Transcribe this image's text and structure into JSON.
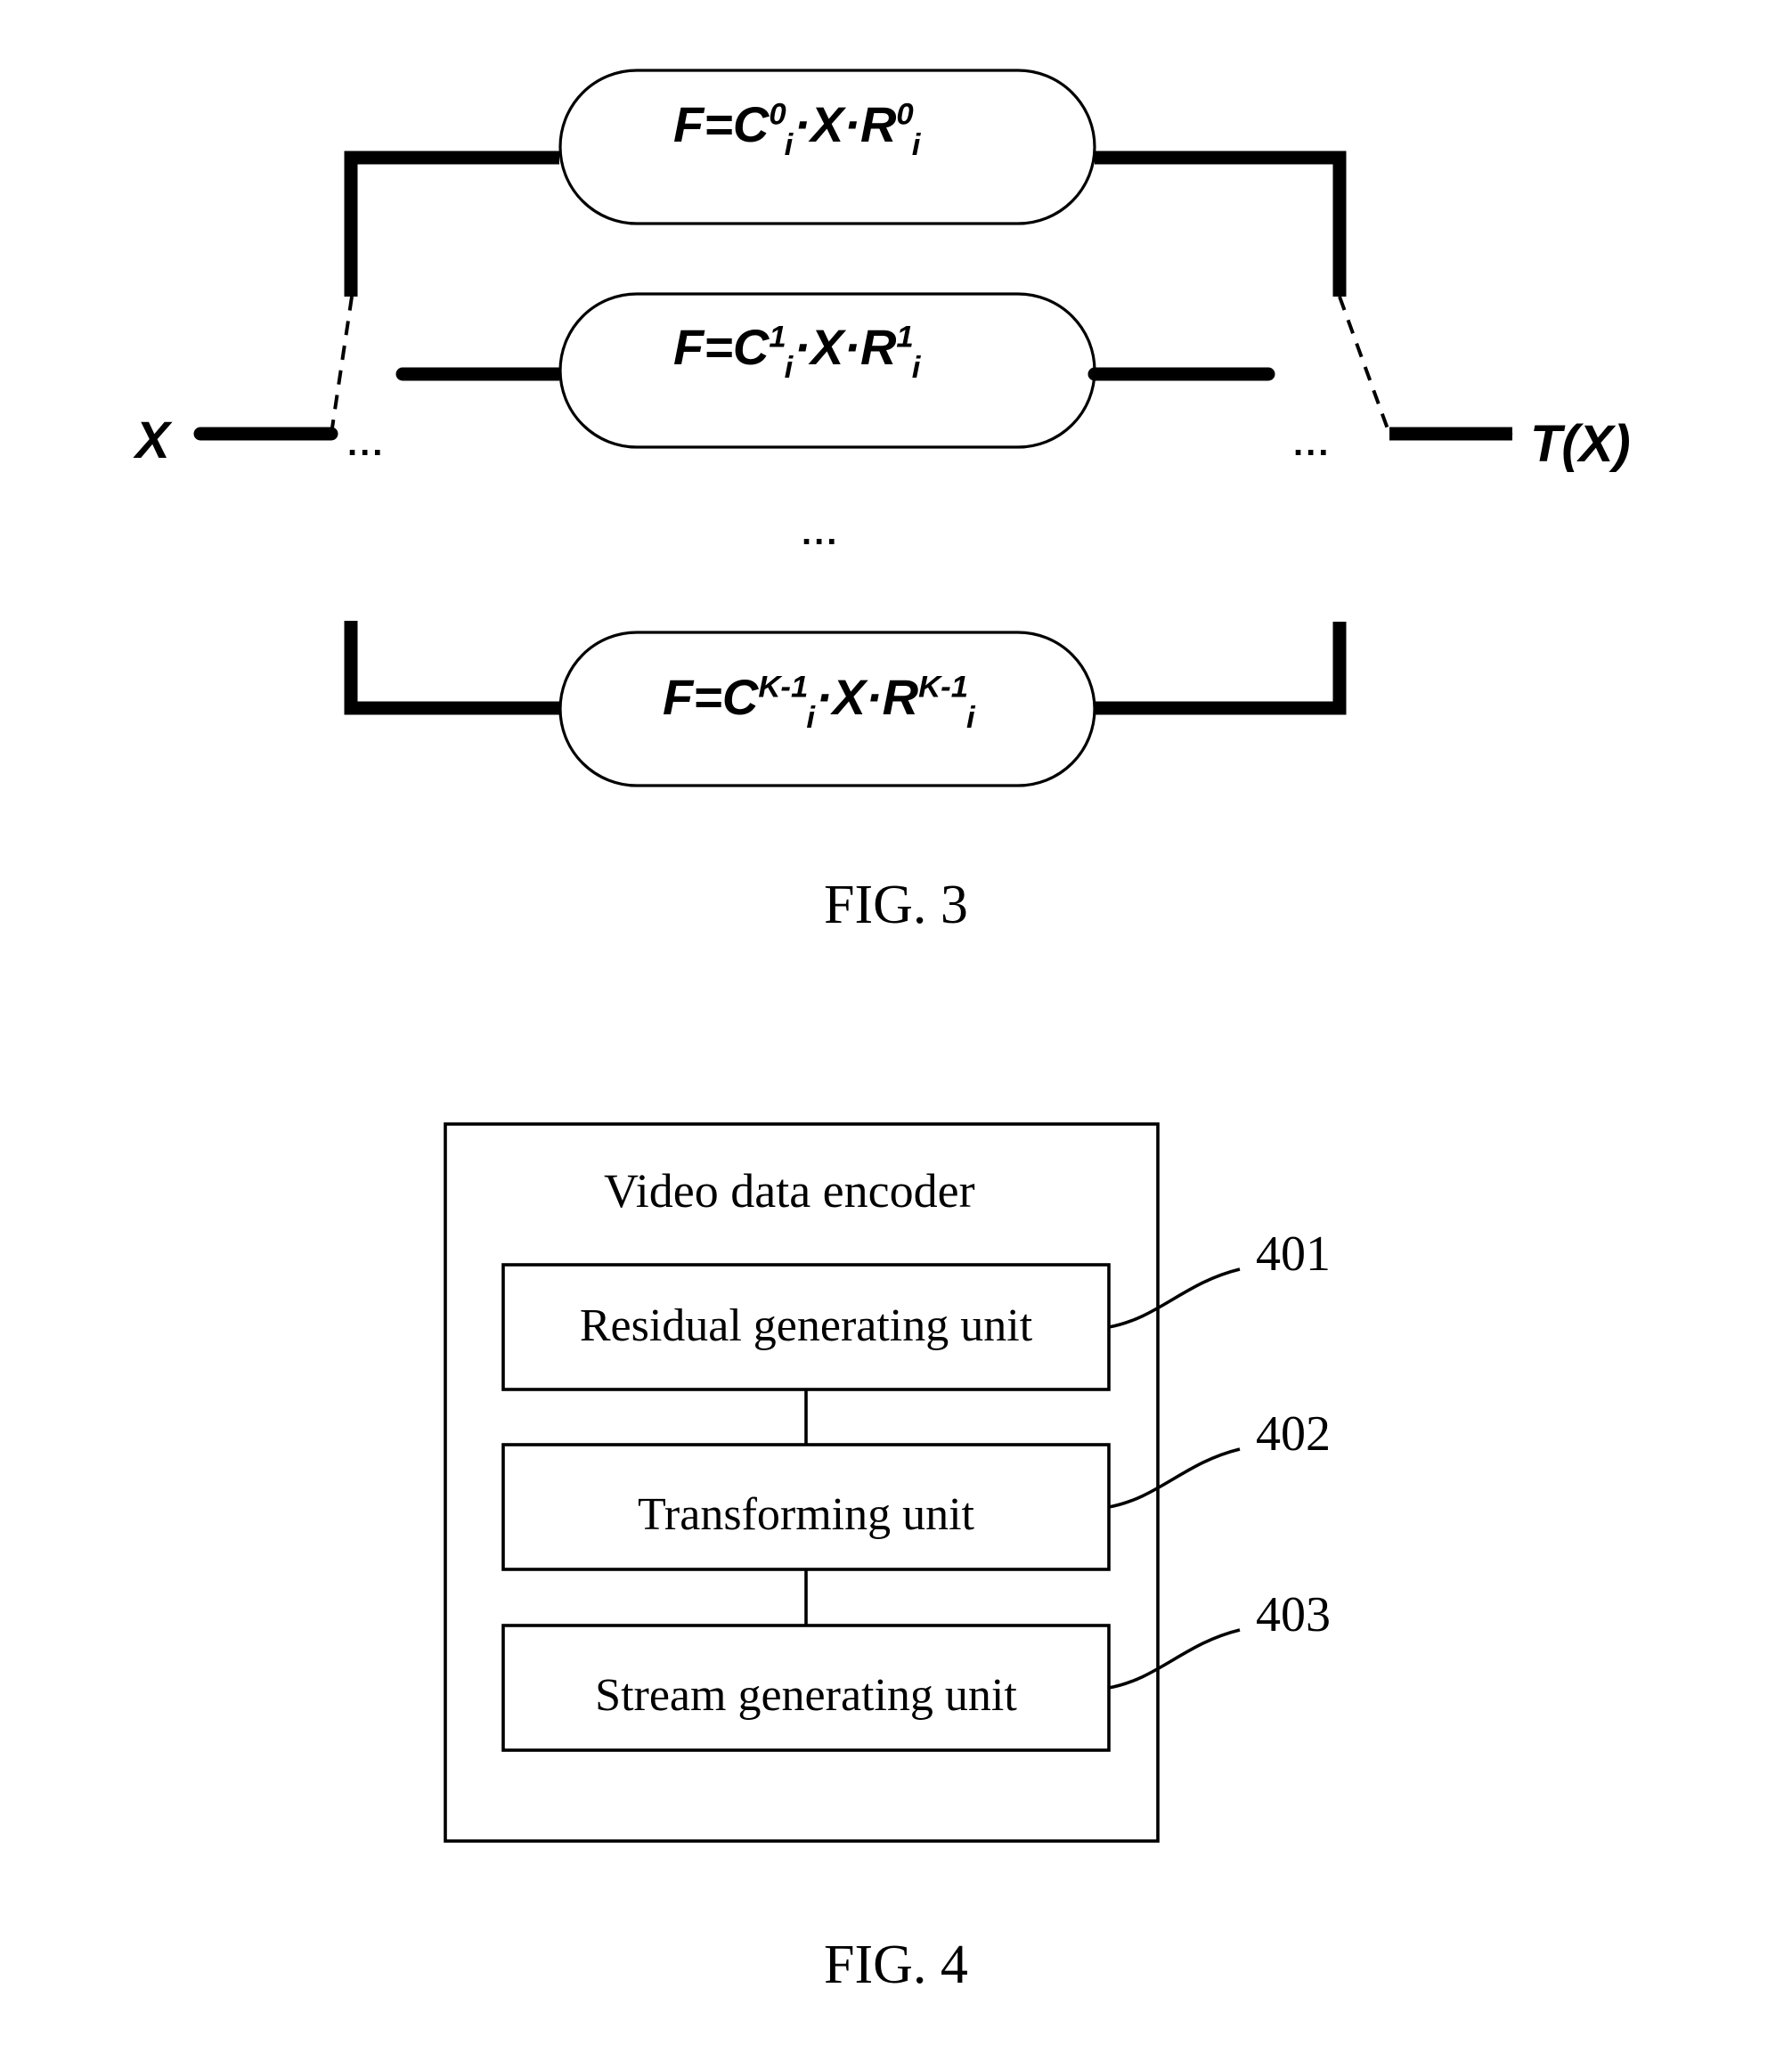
{
  "page": {
    "background_color": "#ffffff",
    "line_color": "#000000"
  },
  "figure3": {
    "caption": "FIG. 3",
    "input_label": "X",
    "output_label": "T(X)",
    "ellipsis_left": "...",
    "ellipsis_right": "...",
    "ellipsis_middle": "...",
    "branches": [
      {
        "index": 0,
        "formula_plain": "F=C0i·X·R0i",
        "lhs": "F=C",
        "exp": "0",
        "sub": "i",
        "mid": "·X·R",
        "exp2": "0",
        "sub2": "i"
      },
      {
        "index": 1,
        "formula_plain": "F=C1i·X·R1i",
        "lhs": "F=C",
        "exp": "1",
        "sub": "i",
        "mid": "·X·R",
        "exp2": "1",
        "sub2": "i"
      },
      {
        "index": 2,
        "formula_plain": "F=CK-1i·X·RK-1i",
        "lhs": "F=C",
        "exp": "K-1",
        "sub": "i",
        "mid": "·X·R",
        "exp2": "K-1",
        "sub2": "i"
      }
    ]
  },
  "figure4": {
    "caption": "FIG. 4",
    "container_title": "Video data encoder",
    "units": [
      {
        "label": "Residual generating unit",
        "ref": "401"
      },
      {
        "label": "Transforming unit",
        "ref": "402"
      },
      {
        "label": "Stream generating unit",
        "ref": "403"
      }
    ]
  }
}
